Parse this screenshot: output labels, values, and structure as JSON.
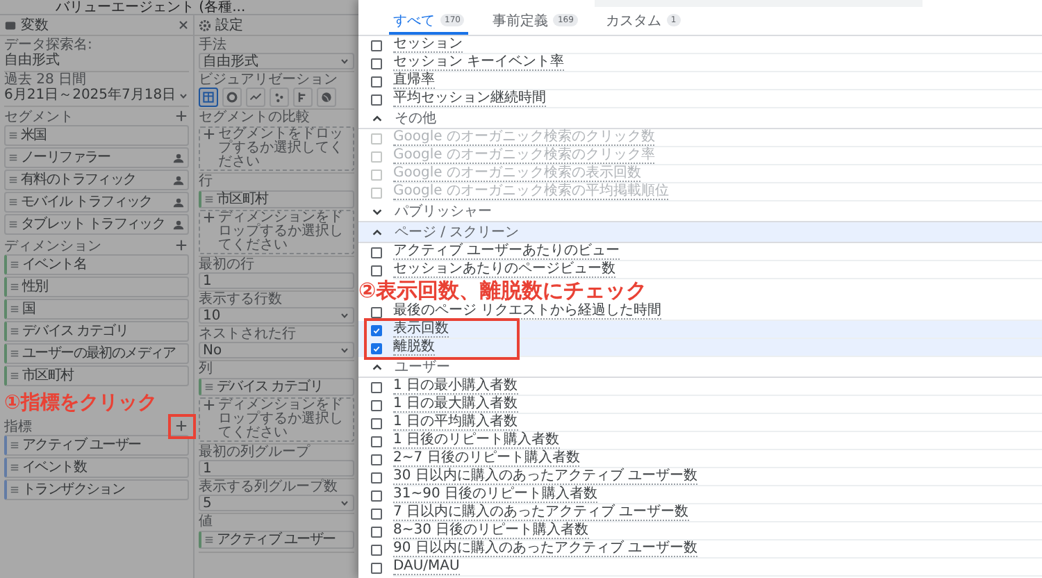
{
  "header": {
    "title": "バリューエージェント (各種..."
  },
  "variables_panel": {
    "title": "変数",
    "fields": [
      {
        "label": "データ探索名:",
        "value": "自由形式",
        "dropdown": false
      },
      {
        "label": "過去 28 日間",
        "value": "6月21日～2025年7月18日",
        "dropdown": true
      }
    ],
    "sections": [
      {
        "title": "セグメント",
        "kind": "segment",
        "items": [
          {
            "label": "米国",
            "audience": false
          },
          {
            "label": "ノーリファラー",
            "audience": true
          },
          {
            "label": "有料のトラフィック",
            "audience": true
          },
          {
            "label": "モバイル トラフィック",
            "audience": true
          },
          {
            "label": "タブレット トラフィック",
            "audience": true
          }
        ]
      },
      {
        "title": "ディメンション",
        "kind": "dimension",
        "items": [
          {
            "label": "イベント名",
            "audience": false
          },
          {
            "label": "性別",
            "audience": false
          },
          {
            "label": "国",
            "audience": false
          },
          {
            "label": "デバイス カテゴリ",
            "audience": false
          },
          {
            "label": "ユーザーの最初のメディア",
            "audience": false
          },
          {
            "label": "市区町村",
            "audience": false
          }
        ]
      },
      {
        "title": "指標",
        "kind": "metric",
        "items": [
          {
            "label": "アクティブ ユーザー",
            "audience": false
          },
          {
            "label": "イベント数",
            "audience": false
          },
          {
            "label": "トランザクション",
            "audience": false
          }
        ]
      }
    ]
  },
  "settings_panel": {
    "title": "設定",
    "sections": [
      {
        "kind": "select",
        "label": "手法",
        "value": "自由形式"
      },
      {
        "kind": "viz",
        "label": "ビジュアリゼーション",
        "options": [
          {
            "kind": "table",
            "selected": true
          },
          {
            "kind": "donut",
            "selected": false
          },
          {
            "kind": "line",
            "selected": false
          },
          {
            "kind": "scatter",
            "selected": false
          },
          {
            "kind": "bar",
            "selected": false
          },
          {
            "kind": "map",
            "selected": false
          }
        ]
      },
      {
        "kind": "drop",
        "label": "セグメントの比較",
        "hint": "セグメントをドロップするか選択してください"
      },
      {
        "kind": "drop",
        "label": "行",
        "chips": [
          "市区町村"
        ],
        "hint": "ディメンションをドロップするか選択してください"
      },
      {
        "kind": "input",
        "label": "最初の行",
        "value": "1"
      },
      {
        "kind": "select",
        "label": "表示する行数",
        "value": "10"
      },
      {
        "kind": "select",
        "label": "ネストされた行",
        "value": "No"
      },
      {
        "kind": "drop",
        "label": "列",
        "chips": [
          "デバイス カテゴリ"
        ],
        "hint": "ディメンションをドロップするか選択してください"
      },
      {
        "kind": "input",
        "label": "最初の列グループ",
        "value": "1"
      },
      {
        "kind": "select",
        "label": "表示する列グループ数",
        "value": "5"
      },
      {
        "kind": "drop",
        "label": "値",
        "chips": [
          "アクティブ ユーザー"
        ]
      }
    ]
  },
  "metric_picker": {
    "tabs": [
      {
        "label": "すべて",
        "count": "170",
        "selected": true
      },
      {
        "label": "事前定義",
        "count": "169",
        "selected": false
      },
      {
        "label": "カスタム",
        "count": "1",
        "selected": false
      }
    ],
    "entries": [
      {
        "kind": "item",
        "label": "セッション",
        "checked": false,
        "disabled": false
      },
      {
        "kind": "item",
        "label": "セッション キーイベント率",
        "checked": false,
        "disabled": false
      },
      {
        "kind": "item",
        "label": "直帰率",
        "checked": false,
        "disabled": false
      },
      {
        "kind": "item",
        "label": "平均セッション継続時間",
        "checked": false,
        "disabled": false
      },
      {
        "kind": "group",
        "label": "その他",
        "expanded": true,
        "highlighted": false
      },
      {
        "kind": "item",
        "label": "Google のオーガニック検索のクリック数",
        "checked": false,
        "disabled": true
      },
      {
        "kind": "item",
        "label": "Google のオーガニック検索のクリック率",
        "checked": false,
        "disabled": true
      },
      {
        "kind": "item",
        "label": "Google のオーガニック検索の表示回数",
        "checked": false,
        "disabled": true
      },
      {
        "kind": "item",
        "label": "Google のオーガニック検索の平均掲載順位",
        "checked": false,
        "disabled": true
      },
      {
        "kind": "group",
        "label": "パブリッシャー",
        "expanded": false,
        "highlighted": false
      },
      {
        "kind": "group",
        "label": "ページ / スクリーン",
        "expanded": true,
        "highlighted": true
      },
      {
        "kind": "item",
        "label": "アクティブ ユーザーあたりのビュー",
        "checked": false,
        "disabled": false
      },
      {
        "kind": "item",
        "label": "セッションあたりのページビュー数",
        "checked": false,
        "disabled": false
      },
      {
        "kind": "annotation",
        "label": "②表示回数、離脱数にチェック"
      },
      {
        "kind": "item",
        "label": "最後のページ リクエストから経過した時間",
        "checked": false,
        "disabled": false
      },
      {
        "kind": "item",
        "label": "表示回数",
        "checked": true,
        "disabled": false
      },
      {
        "kind": "item",
        "label": "離脱数",
        "checked": true,
        "disabled": false
      },
      {
        "kind": "group",
        "label": "ユーザー",
        "expanded": true,
        "highlighted": false
      },
      {
        "kind": "item",
        "label": "1 日の最小購入者数",
        "checked": false,
        "disabled": false
      },
      {
        "kind": "item",
        "label": "1 日の最大購入者数",
        "checked": false,
        "disabled": false
      },
      {
        "kind": "item",
        "label": "1 日の平均購入者数",
        "checked": false,
        "disabled": false
      },
      {
        "kind": "item",
        "label": "1 日後のリピート購入者数",
        "checked": false,
        "disabled": false
      },
      {
        "kind": "item",
        "label": "2~7 日後のリピート購入者数",
        "checked": false,
        "disabled": false
      },
      {
        "kind": "item",
        "label": "30 日以内に購入のあったアクティブ ユーザー数",
        "checked": false,
        "disabled": false
      },
      {
        "kind": "item",
        "label": "31~90 日後のリピート購入者数",
        "checked": false,
        "disabled": false
      },
      {
        "kind": "item",
        "label": "7 日以内に購入のあったアクティブ ユーザー数",
        "checked": false,
        "disabled": false
      },
      {
        "kind": "item",
        "label": "8~30 日後のリピート購入者数",
        "checked": false,
        "disabled": false
      },
      {
        "kind": "item",
        "label": "90 日以内に購入のあったアクティブ ユーザー数",
        "checked": false,
        "disabled": false
      },
      {
        "kind": "item",
        "label": "DAU/MAU",
        "checked": false,
        "disabled": false
      }
    ]
  },
  "callout": {
    "label": "①指標をクリック"
  }
}
